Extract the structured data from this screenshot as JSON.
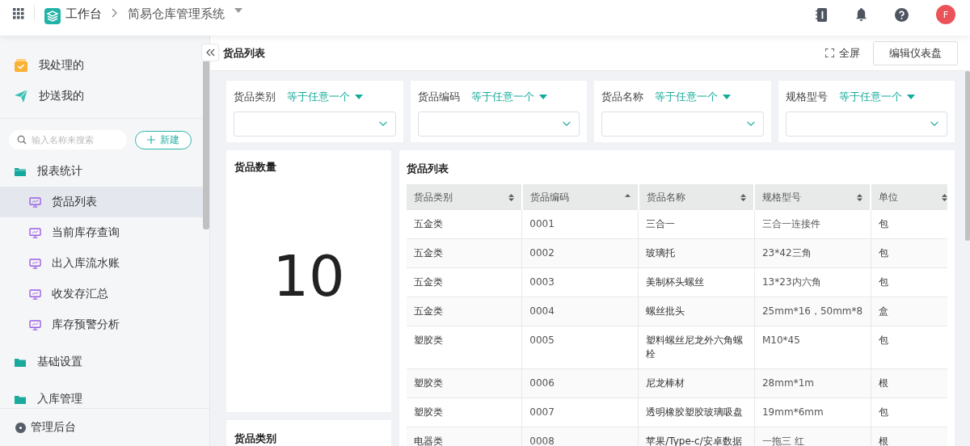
{
  "header": {
    "app": "工作台",
    "breadcrumb": "简易仓库管理系统",
    "avatar": "F"
  },
  "sidebar": {
    "top_items": [
      {
        "label": "我处理的",
        "kind": "todo"
      },
      {
        "label": "抄送我的",
        "kind": "send"
      }
    ],
    "search": {
      "placeholder": "输入名称来搜索"
    },
    "new_button": "新建",
    "tree": [
      {
        "label": "报表统计",
        "expanded": true,
        "children": [
          {
            "label": "货品列表",
            "selected": true
          },
          {
            "label": "当前库存查询",
            "selected": false
          },
          {
            "label": "出入库流水账",
            "selected": false
          },
          {
            "label": "收发存汇总",
            "selected": false
          },
          {
            "label": "库存预警分析",
            "selected": false
          }
        ]
      },
      {
        "label": "基础设置",
        "expanded": false
      },
      {
        "label": "入库管理",
        "expanded": false
      }
    ],
    "footer": "管理后台"
  },
  "page": {
    "title": "货品列表",
    "fullscreen": "全屏",
    "edit_button": "编辑仪表盘"
  },
  "filters": [
    {
      "label": "货品类别",
      "operator": "等于任意一个"
    },
    {
      "label": "货品编码",
      "operator": "等于任意一个"
    },
    {
      "label": "货品名称",
      "operator": "等于任意一个"
    },
    {
      "label": "规格型号",
      "operator": "等于任意一个"
    }
  ],
  "count_card": {
    "title": "货品数量",
    "value": "10"
  },
  "category_card": {
    "title": "货品类别"
  },
  "table": {
    "title": "货品列表",
    "columns": [
      {
        "label": "货品类别",
        "sorted_ascending": false
      },
      {
        "label": "货品编码",
        "sorted_ascending": true
      },
      {
        "label": "货品名称",
        "sorted_ascending": false
      },
      {
        "label": "规格型号",
        "sorted_ascending": false
      },
      {
        "label": "单位",
        "sorted_ascending": false
      }
    ],
    "rows": [
      [
        "五金类",
        "0001",
        "三合一",
        "三合一连接件",
        "包"
      ],
      [
        "五金类",
        "0002",
        "玻璃托",
        "23*42三角",
        "包"
      ],
      [
        "五金类",
        "0003",
        "美制杯头螺丝",
        "13*23内六角",
        "包"
      ],
      [
        "五金类",
        "0004",
        "螺丝批头",
        "25mm*16，50mm*8",
        "盒"
      ],
      [
        "塑胶类",
        "0005",
        "塑料螺丝尼龙外六角螺栓",
        "M10*45",
        "包"
      ],
      [
        "塑胶类",
        "0006",
        "尼龙棒材",
        "28mm*1m",
        "根"
      ],
      [
        "塑胶类",
        "0007",
        "透明橡胶塑胶玻璃吸盘",
        "19mm*6mm",
        "包"
      ],
      [
        "电器类",
        "0008",
        "苹果/Type-c/安卓数据",
        "一拖三 红",
        "根"
      ]
    ]
  }
}
